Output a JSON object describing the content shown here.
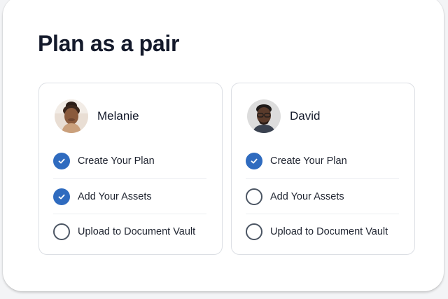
{
  "title": "Plan as a pair",
  "colors": {
    "accent": "#2f6bbf",
    "text": "#141a2b",
    "border": "#dcdfe4"
  },
  "people": [
    {
      "name": "Melanie",
      "avatar": "avatar-photo",
      "tasks": [
        {
          "label": "Create Your Plan",
          "done": true
        },
        {
          "label": "Add Your Assets",
          "done": true
        },
        {
          "label": "Upload to Document Vault",
          "done": false
        }
      ]
    },
    {
      "name": "David",
      "avatar": "avatar-photo",
      "tasks": [
        {
          "label": "Create Your Plan",
          "done": true
        },
        {
          "label": "Add Your Assets",
          "done": false
        },
        {
          "label": "Upload to Document Vault",
          "done": false
        }
      ]
    }
  ]
}
